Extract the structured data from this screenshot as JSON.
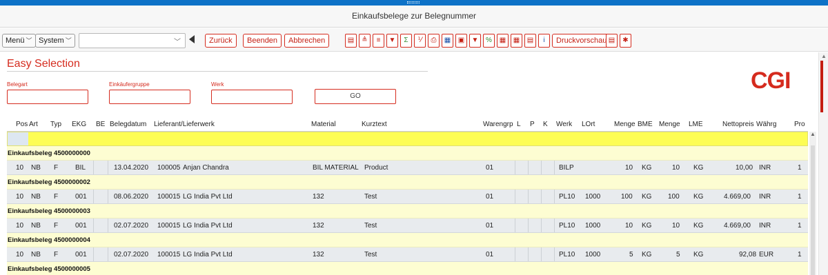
{
  "window": {
    "title": "Einkaufsbelege zur Belegnummer"
  },
  "toolbar": {
    "menu_label": "Menü",
    "system_label": "System",
    "command_field_value": "",
    "back_label": "Zurück",
    "exit_label": "Beenden",
    "cancel_label": "Abbrechen",
    "print_preview_label": "Druckvorschau",
    "icons": [
      "details-icon",
      "sort-ascending-icon",
      "sort-descending-icon",
      "filter-icon",
      "sum-icon",
      "subtotal-icon",
      "print-icon",
      "export-icon",
      "local-file-icon",
      "mail-icon",
      "abc-analysis-icon",
      "table-view-icon",
      "layout-icon",
      "choose-layout-icon",
      "info-icon",
      "document-icon",
      "settings-icon"
    ]
  },
  "easy_selection": {
    "title": "Easy Selection",
    "fields": [
      {
        "label": "Belegart",
        "value": ""
      },
      {
        "label": "Einkäufergruppe",
        "value": ""
      },
      {
        "label": "Werk",
        "value": ""
      }
    ],
    "go_label": "GO"
  },
  "brand": {
    "logo_text": "CGI",
    "accent_color": "#d52b1e"
  },
  "grid": {
    "columns": [
      "Pos",
      "Art",
      "Typ",
      "EKG",
      "BE",
      "Belegdatum",
      "Lieferant/Lieferwerk",
      "Material",
      "Kurztext",
      "Warengrp",
      "L",
      "P",
      "K",
      "Werk",
      "LOrt",
      "Menge",
      "BME",
      "Menge",
      "LME",
      "Nettopreis",
      "Währg",
      "Pro"
    ],
    "groups": [
      {
        "label": "Einkaufsbeleg 4500000000",
        "row": {
          "pos": "10",
          "art": "NB",
          "typ": "F",
          "ekg": "BIL",
          "be": "",
          "belegdatum": "13.04.2020",
          "lieferant": "100005",
          "lieferant_name": "Anjan Chandra",
          "material": "BIL MATERIAL",
          "kurztext": "Product",
          "warengrp": "01",
          "werk": "BILP",
          "lort": "",
          "menge": "10",
          "bme": "KG",
          "menge2": "10",
          "lme": "KG",
          "nettopreis": "10,00",
          "waehrg": "INR",
          "pro": "1"
        }
      },
      {
        "label": "Einkaufsbeleg 4500000002",
        "row": {
          "pos": "10",
          "art": "NB",
          "typ": "F",
          "ekg": "001",
          "be": "",
          "belegdatum": "08.06.2020",
          "lieferant": "100015",
          "lieferant_name": "LG India Pvt Ltd",
          "material": "132",
          "kurztext": "Test",
          "warengrp": "01",
          "werk": "PL10",
          "lort": "1000",
          "menge": "100",
          "bme": "KG",
          "menge2": "100",
          "lme": "KG",
          "nettopreis": "4.669,00",
          "waehrg": "INR",
          "pro": "1"
        }
      },
      {
        "label": "Einkaufsbeleg 4500000003",
        "row": {
          "pos": "10",
          "art": "NB",
          "typ": "F",
          "ekg": "001",
          "be": "",
          "belegdatum": "02.07.2020",
          "lieferant": "100015",
          "lieferant_name": "LG India Pvt Ltd",
          "material": "132",
          "kurztext": "Test",
          "warengrp": "01",
          "werk": "PL10",
          "lort": "1000",
          "menge": "10",
          "bme": "KG",
          "menge2": "10",
          "lme": "KG",
          "nettopreis": "4.669,00",
          "waehrg": "INR",
          "pro": "1"
        }
      },
      {
        "label": "Einkaufsbeleg 4500000004",
        "row": {
          "pos": "10",
          "art": "NB",
          "typ": "F",
          "ekg": "001",
          "be": "",
          "belegdatum": "02.07.2020",
          "lieferant": "100015",
          "lieferant_name": "LG India Pvt Ltd",
          "material": "132",
          "kurztext": "Test",
          "warengrp": "01",
          "werk": "PL10",
          "lort": "1000",
          "menge": "5",
          "bme": "KG",
          "menge2": "5",
          "lme": "KG",
          "nettopreis": "92,08",
          "waehrg": "EUR",
          "pro": "1"
        }
      },
      {
        "label": "Einkaufsbeleg 4500000005"
      }
    ]
  }
}
